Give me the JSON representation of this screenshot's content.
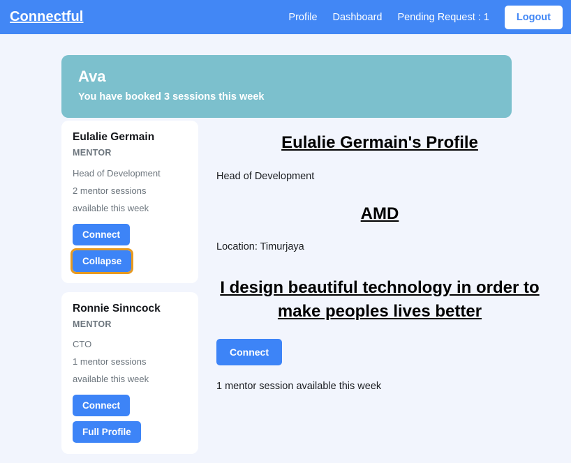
{
  "navbar": {
    "brand": "Connectful",
    "links": [
      {
        "label": "Profile",
        "name": "nav-link-profile"
      },
      {
        "label": "Dashboard",
        "name": "nav-link-dashboard"
      },
      {
        "label": "Pending Request : 1",
        "name": "nav-link-pending-request"
      }
    ],
    "logout_label": "Logout"
  },
  "welcome": {
    "name": "Ava",
    "message": "You have booked 3 sessions this week"
  },
  "mentor_list": [
    {
      "name": "Eulalie Germain",
      "role_label": "MENTOR",
      "title": "Head of Development",
      "sessions_line1": "2 mentor sessions",
      "sessions_line2": "available this week",
      "connect_label": "Connect",
      "toggle_label": "Collapse",
      "toggle_focused": true
    },
    {
      "name": "Ronnie Sinncock",
      "role_label": "MENTOR",
      "title": "CTO",
      "sessions_line1": "1 mentor sessions",
      "sessions_line2": "available this week",
      "connect_label": "Connect",
      "toggle_label": "Full Profile",
      "toggle_focused": false
    }
  ],
  "profile": {
    "heading": "Eulalie Germain's Profile",
    "title": "Head of Development",
    "company": "AMD",
    "location": "Location: Timurjaya",
    "bio": "I design beautiful technology in order to make peoples lives better",
    "connect_label": "Connect",
    "availability": "1 mentor session available this week"
  },
  "colors": {
    "nav_blue": "#4287f5",
    "button_blue": "#3d84f7",
    "banner_teal": "#7cc0cd",
    "page_background": "#f2f5fd",
    "focus_ring_orange": "#e79a21",
    "muted_text": "#6c757d",
    "card_white": "#ffffff"
  }
}
